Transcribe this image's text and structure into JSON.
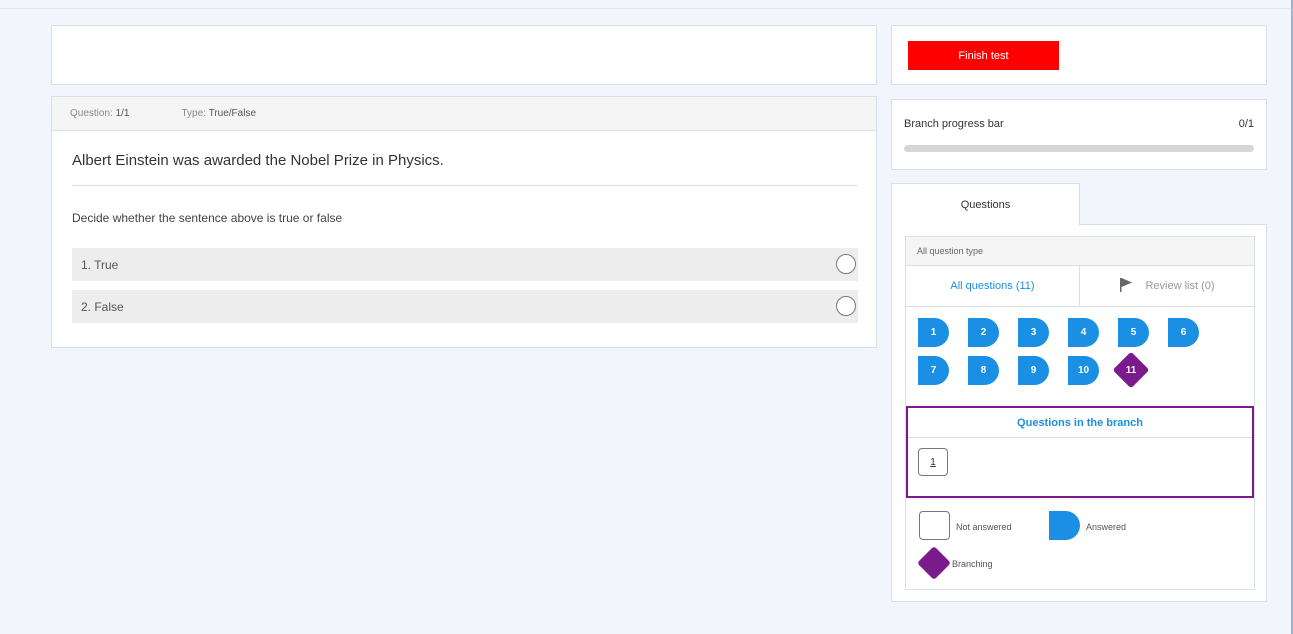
{
  "question": {
    "meta_question_label": "Question:",
    "meta_question_value": "1/1",
    "meta_type_label": "Type:",
    "meta_type_value": "True/False",
    "text": "Albert Einstein was awarded the Nobel Prize in Physics.",
    "instruction": "Decide whether the sentence above is true or false",
    "options": [
      {
        "label": "1. True",
        "selected": false
      },
      {
        "label": "2. False",
        "selected": false
      }
    ]
  },
  "sidebar": {
    "finish_button": "Finish test",
    "progress": {
      "label": "Branch progress bar",
      "count": "0/1",
      "fraction": 0
    },
    "tab_label": "Questions",
    "type_label": "All question type",
    "filter_all": "All questions (11)",
    "filter_review": "Review list (0)",
    "questions": [
      {
        "num": "1",
        "state": "answered"
      },
      {
        "num": "2",
        "state": "answered"
      },
      {
        "num": "3",
        "state": "answered"
      },
      {
        "num": "4",
        "state": "answered"
      },
      {
        "num": "5",
        "state": "answered"
      },
      {
        "num": "6",
        "state": "answered"
      },
      {
        "num": "7",
        "state": "answered"
      },
      {
        "num": "8",
        "state": "answered"
      },
      {
        "num": "9",
        "state": "answered"
      },
      {
        "num": "10",
        "state": "answered"
      },
      {
        "num": "11",
        "state": "branching"
      }
    ],
    "branch": {
      "title": "Questions in the branch",
      "items": [
        "1"
      ]
    },
    "legend": {
      "not_answered": "Not answered",
      "answered": "Answered",
      "branching": "Branching"
    }
  },
  "colors": {
    "accent": "#1a8fe3",
    "branch": "#7a1a8c",
    "finish": "#ff0000"
  },
  "icons": {
    "review": "flag-icon",
    "option": "radio-icon"
  }
}
